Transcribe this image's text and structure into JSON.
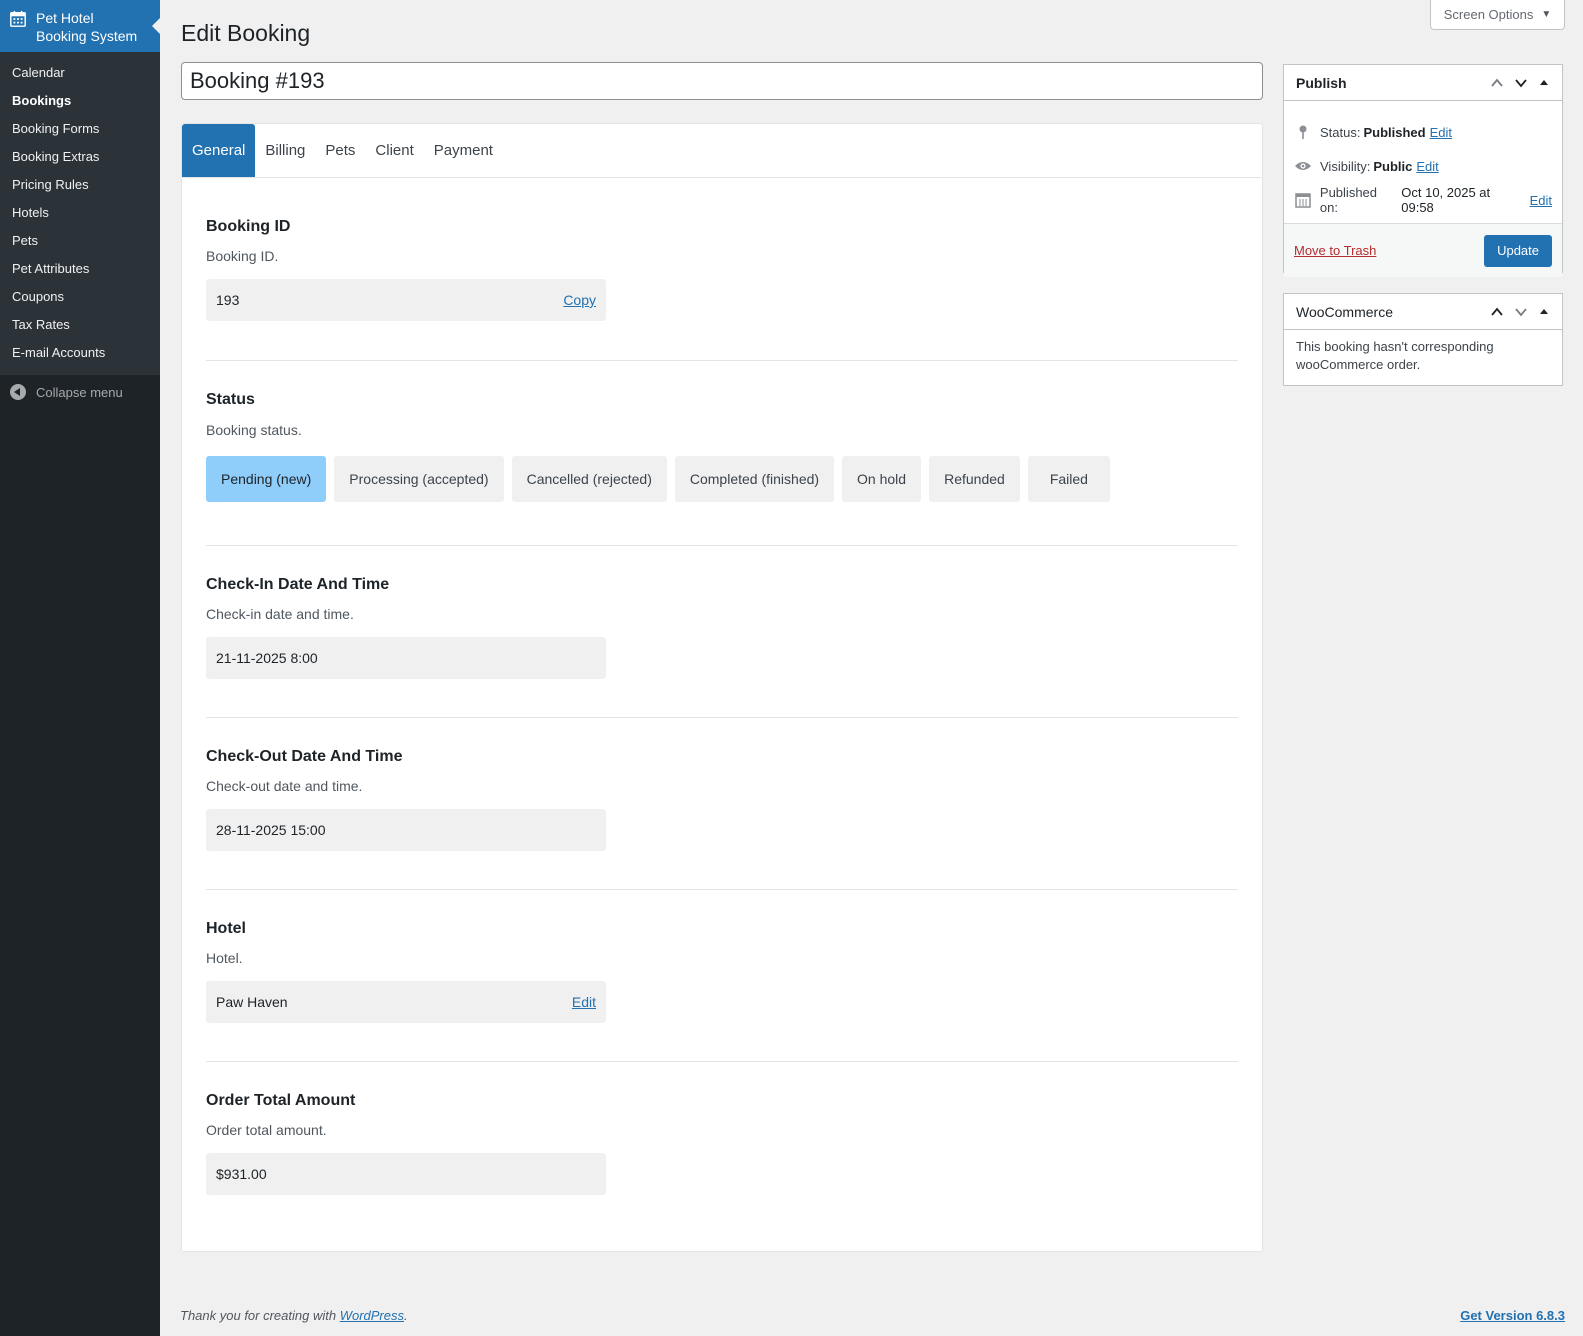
{
  "sidebar": {
    "plugin_title": "Pet Hotel Booking System",
    "items": [
      {
        "label": "Calendar"
      },
      {
        "label": "Bookings"
      },
      {
        "label": "Booking Forms"
      },
      {
        "label": "Booking Extras"
      },
      {
        "label": "Pricing Rules"
      },
      {
        "label": "Hotels"
      },
      {
        "label": "Pets"
      },
      {
        "label": "Pet Attributes"
      },
      {
        "label": "Coupons"
      },
      {
        "label": "Tax Rates"
      },
      {
        "label": "E-mail Accounts"
      }
    ],
    "current_item": "Bookings",
    "collapse_label": "Collapse menu"
  },
  "header": {
    "screen_options": "Screen Options",
    "page_title": "Edit Booking",
    "post_title": "Booking #193"
  },
  "tabs": [
    {
      "label": "General",
      "active": true
    },
    {
      "label": "Billing"
    },
    {
      "label": "Pets"
    },
    {
      "label": "Client"
    },
    {
      "label": "Payment"
    }
  ],
  "fields": {
    "booking_id": {
      "title": "Booking ID",
      "desc": "Booking ID.",
      "value": "193",
      "action": "Copy"
    },
    "status": {
      "title": "Status",
      "desc": "Booking status.",
      "options": [
        {
          "label": "Pending (new)",
          "active": true
        },
        {
          "label": "Processing (accepted)"
        },
        {
          "label": "Cancelled (rejected)"
        },
        {
          "label": "Completed (finished)"
        },
        {
          "label": "On hold"
        },
        {
          "label": "Refunded"
        },
        {
          "label": "Failed"
        }
      ]
    },
    "check_in": {
      "title": "Check-In Date And Time",
      "desc": "Check-in date and time.",
      "value": "21-11-2025 8:00"
    },
    "check_out": {
      "title": "Check-Out Date And Time",
      "desc": "Check-out date and time.",
      "value": "28-11-2025 15:00"
    },
    "hotel": {
      "title": "Hotel",
      "desc": "Hotel.",
      "value": "Paw Haven",
      "action": "Edit"
    },
    "order_total": {
      "title": "Order Total Amount",
      "desc": "Order total amount.",
      "value": "$931.00"
    }
  },
  "publish": {
    "title": "Publish",
    "status_label": "Status:",
    "status_value": "Published",
    "visibility_label": "Visibility:",
    "visibility_value": "Public",
    "published_label": "Published on:",
    "published_value": "Oct 10, 2025 at 09:58",
    "edit_link": "Edit",
    "trash_label": "Move to Trash",
    "update_label": "Update"
  },
  "woocommerce": {
    "title": "WooCommerce",
    "message": "This booking hasn't corresponding wooCommerce order."
  },
  "footer": {
    "thanks_prefix": "Thank you for creating with",
    "thanks_link": "WordPress",
    "thanks_suffix": ".",
    "version": "Get Version 6.8.3"
  },
  "colors": {
    "accent": "#2271b1",
    "sidebar_bg": "#1d2327",
    "active_status": "#8fcdfb",
    "trash": "#b32d2e"
  }
}
